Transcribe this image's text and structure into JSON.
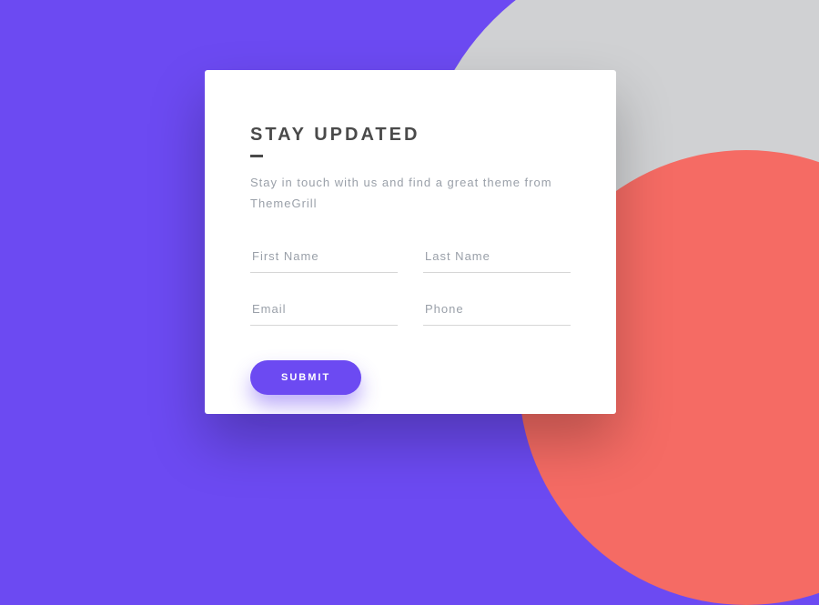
{
  "form": {
    "heading": "STAY UPDATED",
    "subtext": "Stay in touch with us and find a great theme from ThemeGrill",
    "fields": {
      "first_name": {
        "placeholder": "First Name",
        "value": ""
      },
      "last_name": {
        "placeholder": "Last Name",
        "value": ""
      },
      "email": {
        "placeholder": "Email",
        "value": ""
      },
      "phone": {
        "placeholder": "Phone",
        "value": ""
      }
    },
    "submit_label": "SUBMIT"
  },
  "colors": {
    "primary": "#6c4af2",
    "accent": "#f56b64",
    "neutral": "#d0d1d3"
  }
}
